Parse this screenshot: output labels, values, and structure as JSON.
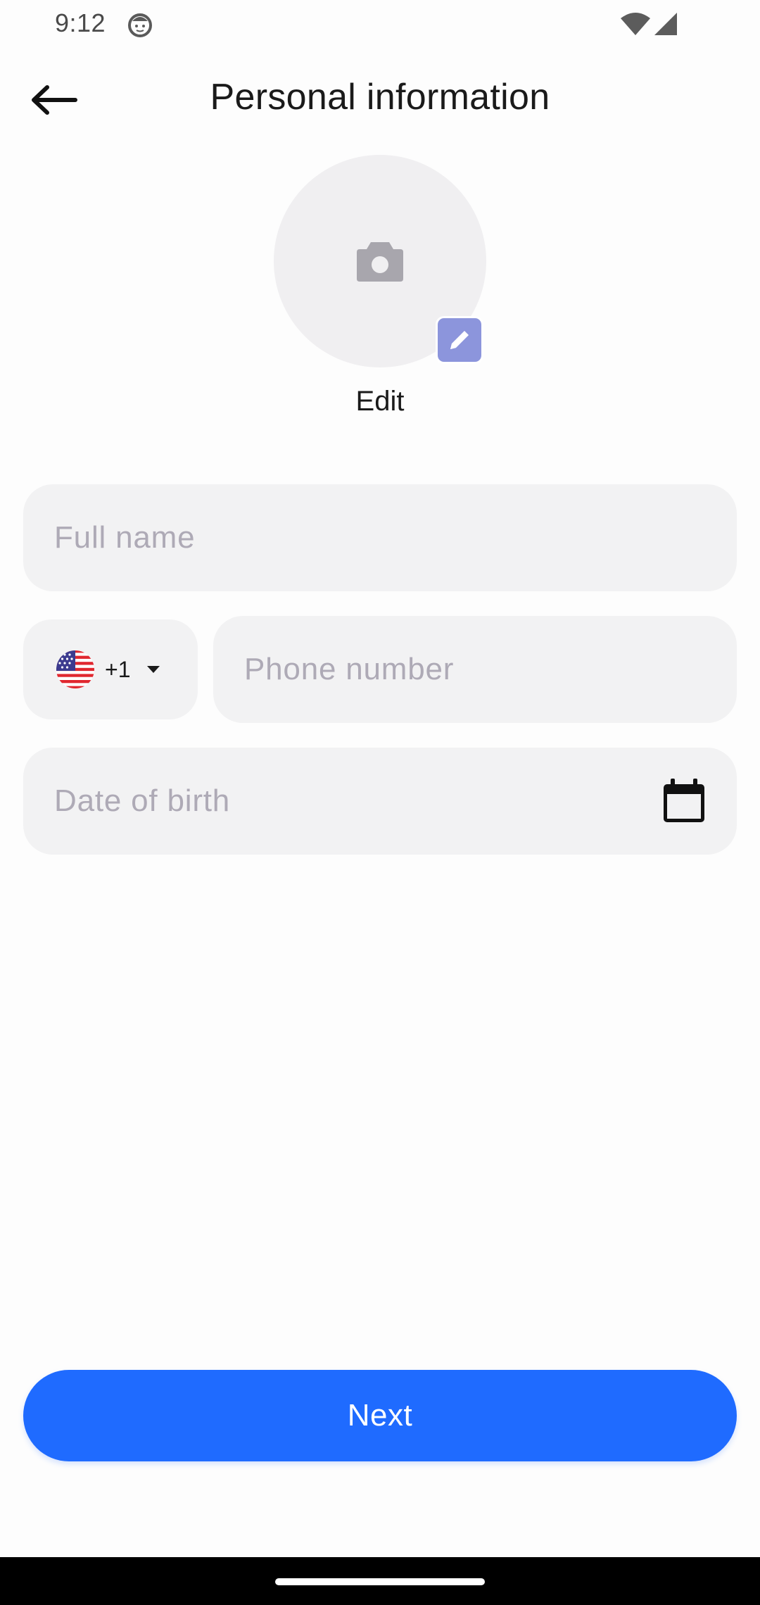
{
  "status_bar": {
    "time": "9:12",
    "app_icon": "smiley-face-icon",
    "wifi_icon": "wifi-icon",
    "signal_icon": "cell-signal-icon"
  },
  "header": {
    "back_icon": "arrow-left-icon",
    "title": "Personal information"
  },
  "avatar": {
    "placeholder_icon": "camera-icon",
    "edit_badge_icon": "pencil-icon",
    "edit_label": "Edit"
  },
  "form": {
    "full_name": {
      "value": "",
      "placeholder": "Full name"
    },
    "country": {
      "flag_icon": "us-flag-icon",
      "code": "+1",
      "dropdown_icon": "caret-down-icon"
    },
    "phone": {
      "value": "",
      "placeholder": "Phone number"
    },
    "dob": {
      "value": "",
      "placeholder": "Date of birth",
      "icon": "calendar-icon"
    }
  },
  "actions": {
    "next_label": "Next"
  },
  "colors": {
    "primary": "#1f6bff",
    "field_bg": "#f2f2f3",
    "placeholder": "#aeaab6",
    "edit_badge": "#8c95dc",
    "avatar_bg": "#f0eff1"
  }
}
